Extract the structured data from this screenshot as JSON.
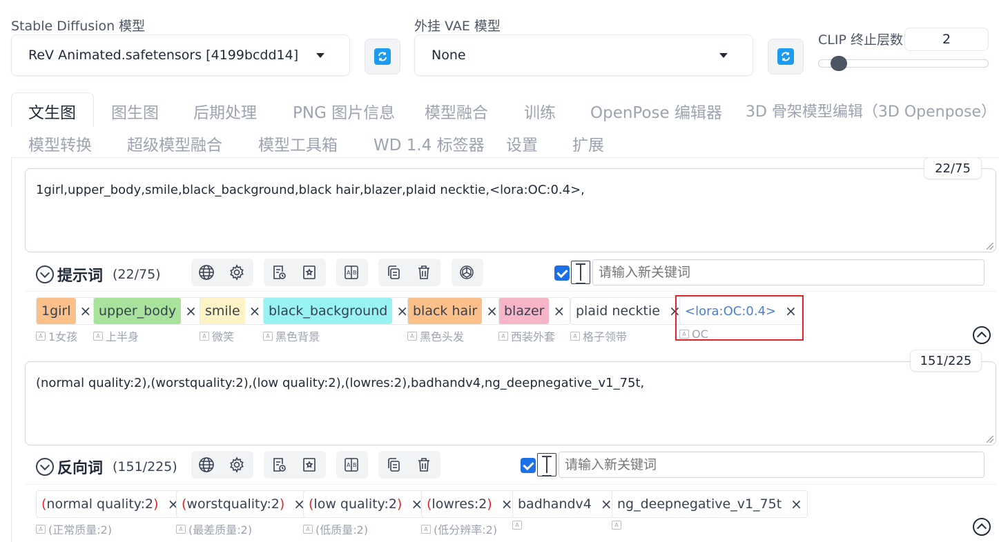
{
  "models": {
    "sd_label": "Stable Diffusion 模型",
    "sd_value": "ReV Animated.safetensors [4199bcdd14]",
    "vae_label": "外挂 VAE 模型",
    "vae_value": "None",
    "clip_label": "CLIP 终止层数",
    "clip_value": "2",
    "clip_slider": {
      "min": 1,
      "max": 12,
      "value": 2
    }
  },
  "tabs": {
    "row1": [
      "文生图",
      "图生图",
      "后期处理",
      "PNG 图片信息",
      "模型融合",
      "训练",
      "OpenPose 编辑器",
      "3D 骨架模型编辑（3D Openpose）"
    ],
    "row2": [
      "模型转换",
      "超级模型融合",
      "模型工具箱",
      "WD 1.4 标签器",
      "设置",
      "扩展"
    ]
  },
  "prompt": {
    "text": "1girl,upper_body,smile,black_background,black hair,blazer,plaid necktie,<lora:OC:0.4>,",
    "counter": "22/75",
    "title": "提示词",
    "count": "(22/75)",
    "placeholder": "请输入新关键词",
    "tags": [
      {
        "text": "1girl",
        "trans": "1女孩",
        "bg": "#fbbf8a"
      },
      {
        "text": "upper_body",
        "trans": "上半身",
        "bg": "#a7e39a"
      },
      {
        "text": "smile",
        "trans": "微笑",
        "bg": "#fdf3c4"
      },
      {
        "text": "black_background",
        "trans": "黑色背景",
        "bg": "#99f2f2"
      },
      {
        "text": "black hair",
        "trans": "黑色头发",
        "bg": "#fbbf8a"
      },
      {
        "text": "blazer",
        "trans": "西装外套",
        "bg": "#f7b6c8"
      },
      {
        "text": "plaid necktie",
        "trans": "格子领带",
        "bg": "#ffffff"
      },
      {
        "text": "<lora:OC:0.4>",
        "trans": "OC",
        "bg": "#ffffff"
      }
    ]
  },
  "negative": {
    "text": "(normal quality:2),(worstquality:2),(low quality:2),(lowres:2),badhandv4,ng_deepnegative_v1_75t,",
    "counter": "151/225",
    "title": "反向词",
    "count": "(151/225)",
    "placeholder": "请输入新关键词",
    "tags": [
      {
        "pre": "(",
        "inner": "normal quality:2",
        "post": ")",
        "trans": "(正常质量:2)"
      },
      {
        "pre": "(",
        "inner": "worstquality:2",
        "post": ")",
        "trans": "(最差质量:2)"
      },
      {
        "pre": "(",
        "inner": "low quality:2",
        "post": ")",
        "trans": "(低质量:2)"
      },
      {
        "pre": "(",
        "inner": "lowres:2",
        "post": ")",
        "trans": "(低分辨率:2)"
      },
      {
        "pre": "",
        "inner": "badhandv4",
        "post": "",
        "trans": ""
      },
      {
        "pre": "",
        "inner": "ng_deepnegative_v1_75t",
        "post": "",
        "trans": ""
      }
    ]
  },
  "icons": [
    "refresh-icon",
    "globe-icon",
    "gear-icon",
    "history-icon",
    "bookmark-icon",
    "translate-icon",
    "copy-icon",
    "trash-icon",
    "openai-icon",
    "text-cursor-icon",
    "collapse-icon"
  ],
  "colors": {
    "accent": "#1d6fe8",
    "refresh": "#1d9bf0",
    "highlight": "#dc2626",
    "lora": "#4a7fd0",
    "teal": "#14a8a0"
  }
}
